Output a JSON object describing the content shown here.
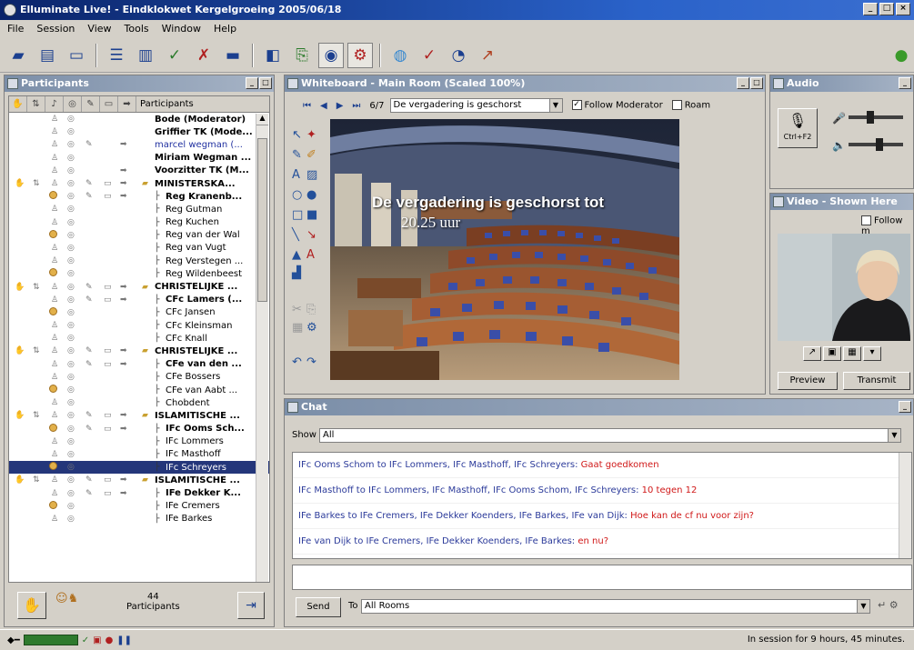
{
  "window": {
    "title": "Elluminate Live! - Eindklokwet Kergelgroeing 2005/06/18"
  },
  "menu": [
    "File",
    "Session",
    "View",
    "Tools",
    "Window",
    "Help"
  ],
  "toolbar": {
    "icons": [
      "save-icon",
      "print-icon",
      "layout-icon",
      "list-icon",
      "chart-icon",
      "check-icon",
      "tool-icon",
      "monitor-icon",
      "window-icon",
      "export-icon",
      "eye-icon",
      "share-icon",
      "globe-icon",
      "quiz-icon",
      "timer-icon",
      "graph-icon",
      "green-icon"
    ]
  },
  "participants": {
    "title": "Participants",
    "header_label": "Participants",
    "rows": [
      {
        "name": "Bode (Moderator)",
        "style": "bold",
        "indent": 0
      },
      {
        "name": "Griffier TK (Mode...",
        "style": "bold",
        "indent": 0
      },
      {
        "name": "marcel wegman (...",
        "style": "blue",
        "indent": 0
      },
      {
        "name": "Miriam Wegman ...",
        "style": "bold",
        "indent": 0
      },
      {
        "name": "Voorzitter TK (M...",
        "style": "bold",
        "indent": 0
      },
      {
        "name": "MINISTERSKA...",
        "style": "group",
        "indent": 0
      },
      {
        "name": "Reg Kranenb...",
        "style": "bold",
        "indent": 1
      },
      {
        "name": "Reg Gutman",
        "style": "",
        "indent": 1
      },
      {
        "name": "Reg Kuchen",
        "style": "",
        "indent": 1
      },
      {
        "name": "Reg van der Wal",
        "style": "",
        "indent": 1
      },
      {
        "name": "Reg van Vugt",
        "style": "",
        "indent": 1
      },
      {
        "name": "Reg Verstegen ...",
        "style": "",
        "indent": 1
      },
      {
        "name": "Reg Wildenbeest",
        "style": "",
        "indent": 1
      },
      {
        "name": "CHRISTELIJKE ...",
        "style": "group",
        "indent": 0
      },
      {
        "name": "CFc Lamers (...",
        "style": "bold",
        "indent": 1
      },
      {
        "name": "CFc Jansen",
        "style": "",
        "indent": 1
      },
      {
        "name": "CFc Kleinsman",
        "style": "",
        "indent": 1
      },
      {
        "name": "CFc Knall",
        "style": "",
        "indent": 1
      },
      {
        "name": "CHRISTELIJKE ...",
        "style": "group",
        "indent": 0
      },
      {
        "name": "CFe van den ...",
        "style": "bold",
        "indent": 1
      },
      {
        "name": "CFe Bossers",
        "style": "",
        "indent": 1
      },
      {
        "name": "CFe van Aabt ...",
        "style": "",
        "indent": 1
      },
      {
        "name": "Chobdent",
        "style": "",
        "indent": 1
      },
      {
        "name": "ISLAMITISCHE ...",
        "style": "group",
        "indent": 0
      },
      {
        "name": "IFc Ooms Sch...",
        "style": "bold",
        "indent": 1
      },
      {
        "name": "IFc Lommers",
        "style": "",
        "indent": 1
      },
      {
        "name": "IFc Masthoff",
        "style": "",
        "indent": 1
      },
      {
        "name": "IFc Schreyers",
        "style": "selected",
        "indent": 1
      },
      {
        "name": "ISLAMITISCHE ...",
        "style": "group",
        "indent": 0
      },
      {
        "name": "IFe Dekker K...",
        "style": "bold",
        "indent": 1
      },
      {
        "name": "IFe Cremers",
        "style": "",
        "indent": 1
      },
      {
        "name": "IFe Barkes",
        "style": "",
        "indent": 1
      }
    ],
    "count": "44",
    "count_label": "Participants"
  },
  "whiteboard": {
    "title": "Whiteboard - Main Room (Scaled 100%)",
    "page_label": "6/7",
    "page_select": "De vergadering is geschorst",
    "follow_moderator": "Follow Moderator",
    "roam": "Roam",
    "slide_line1": "De vergadering is geschorst tot",
    "slide_line2": "20.25 uur"
  },
  "audio": {
    "title": "Audio",
    "talk_label": "Ctrl+F2"
  },
  "video": {
    "title": "Video - Shown Here",
    "follow_label": "Follow m",
    "preview": "Preview",
    "transmit": "Transmit"
  },
  "chat": {
    "title": "Chat",
    "show_label": "Show",
    "show_value": "All",
    "messages": [
      {
        "who": "IFc Ooms Schom to IFc Lommers, IFc Masthoff, IFc Schreyers:",
        "text": "Gaat goedkomen"
      },
      {
        "who": "IFc Masthoff to IFc Lommers, IFc Masthoff, IFc Ooms Schom, IFc Schreyers:",
        "text": "10 tegen 12"
      },
      {
        "who": "IFe Barkes to IFe Cremers, IFe Dekker Koenders, IFe Barkes, IFe van Dijk:",
        "text": "Hoe kan de cf nu voor zijn?"
      },
      {
        "who": "IFe van Dijk to IFe Cremers, IFe Dekker Koenders, IFe Barkes:",
        "text": "en nu?"
      }
    ],
    "send": "Send",
    "to_label": "To",
    "to_value": "All Rooms"
  },
  "status": {
    "text": "In session for 9 hours, 45 minutes."
  },
  "colors": {
    "title_blue": "#0a246a",
    "panel_title": "#7b8ea8",
    "chat_red": "#d01818",
    "chat_blue": "#2b3a9a",
    "selection": "#24367a"
  }
}
